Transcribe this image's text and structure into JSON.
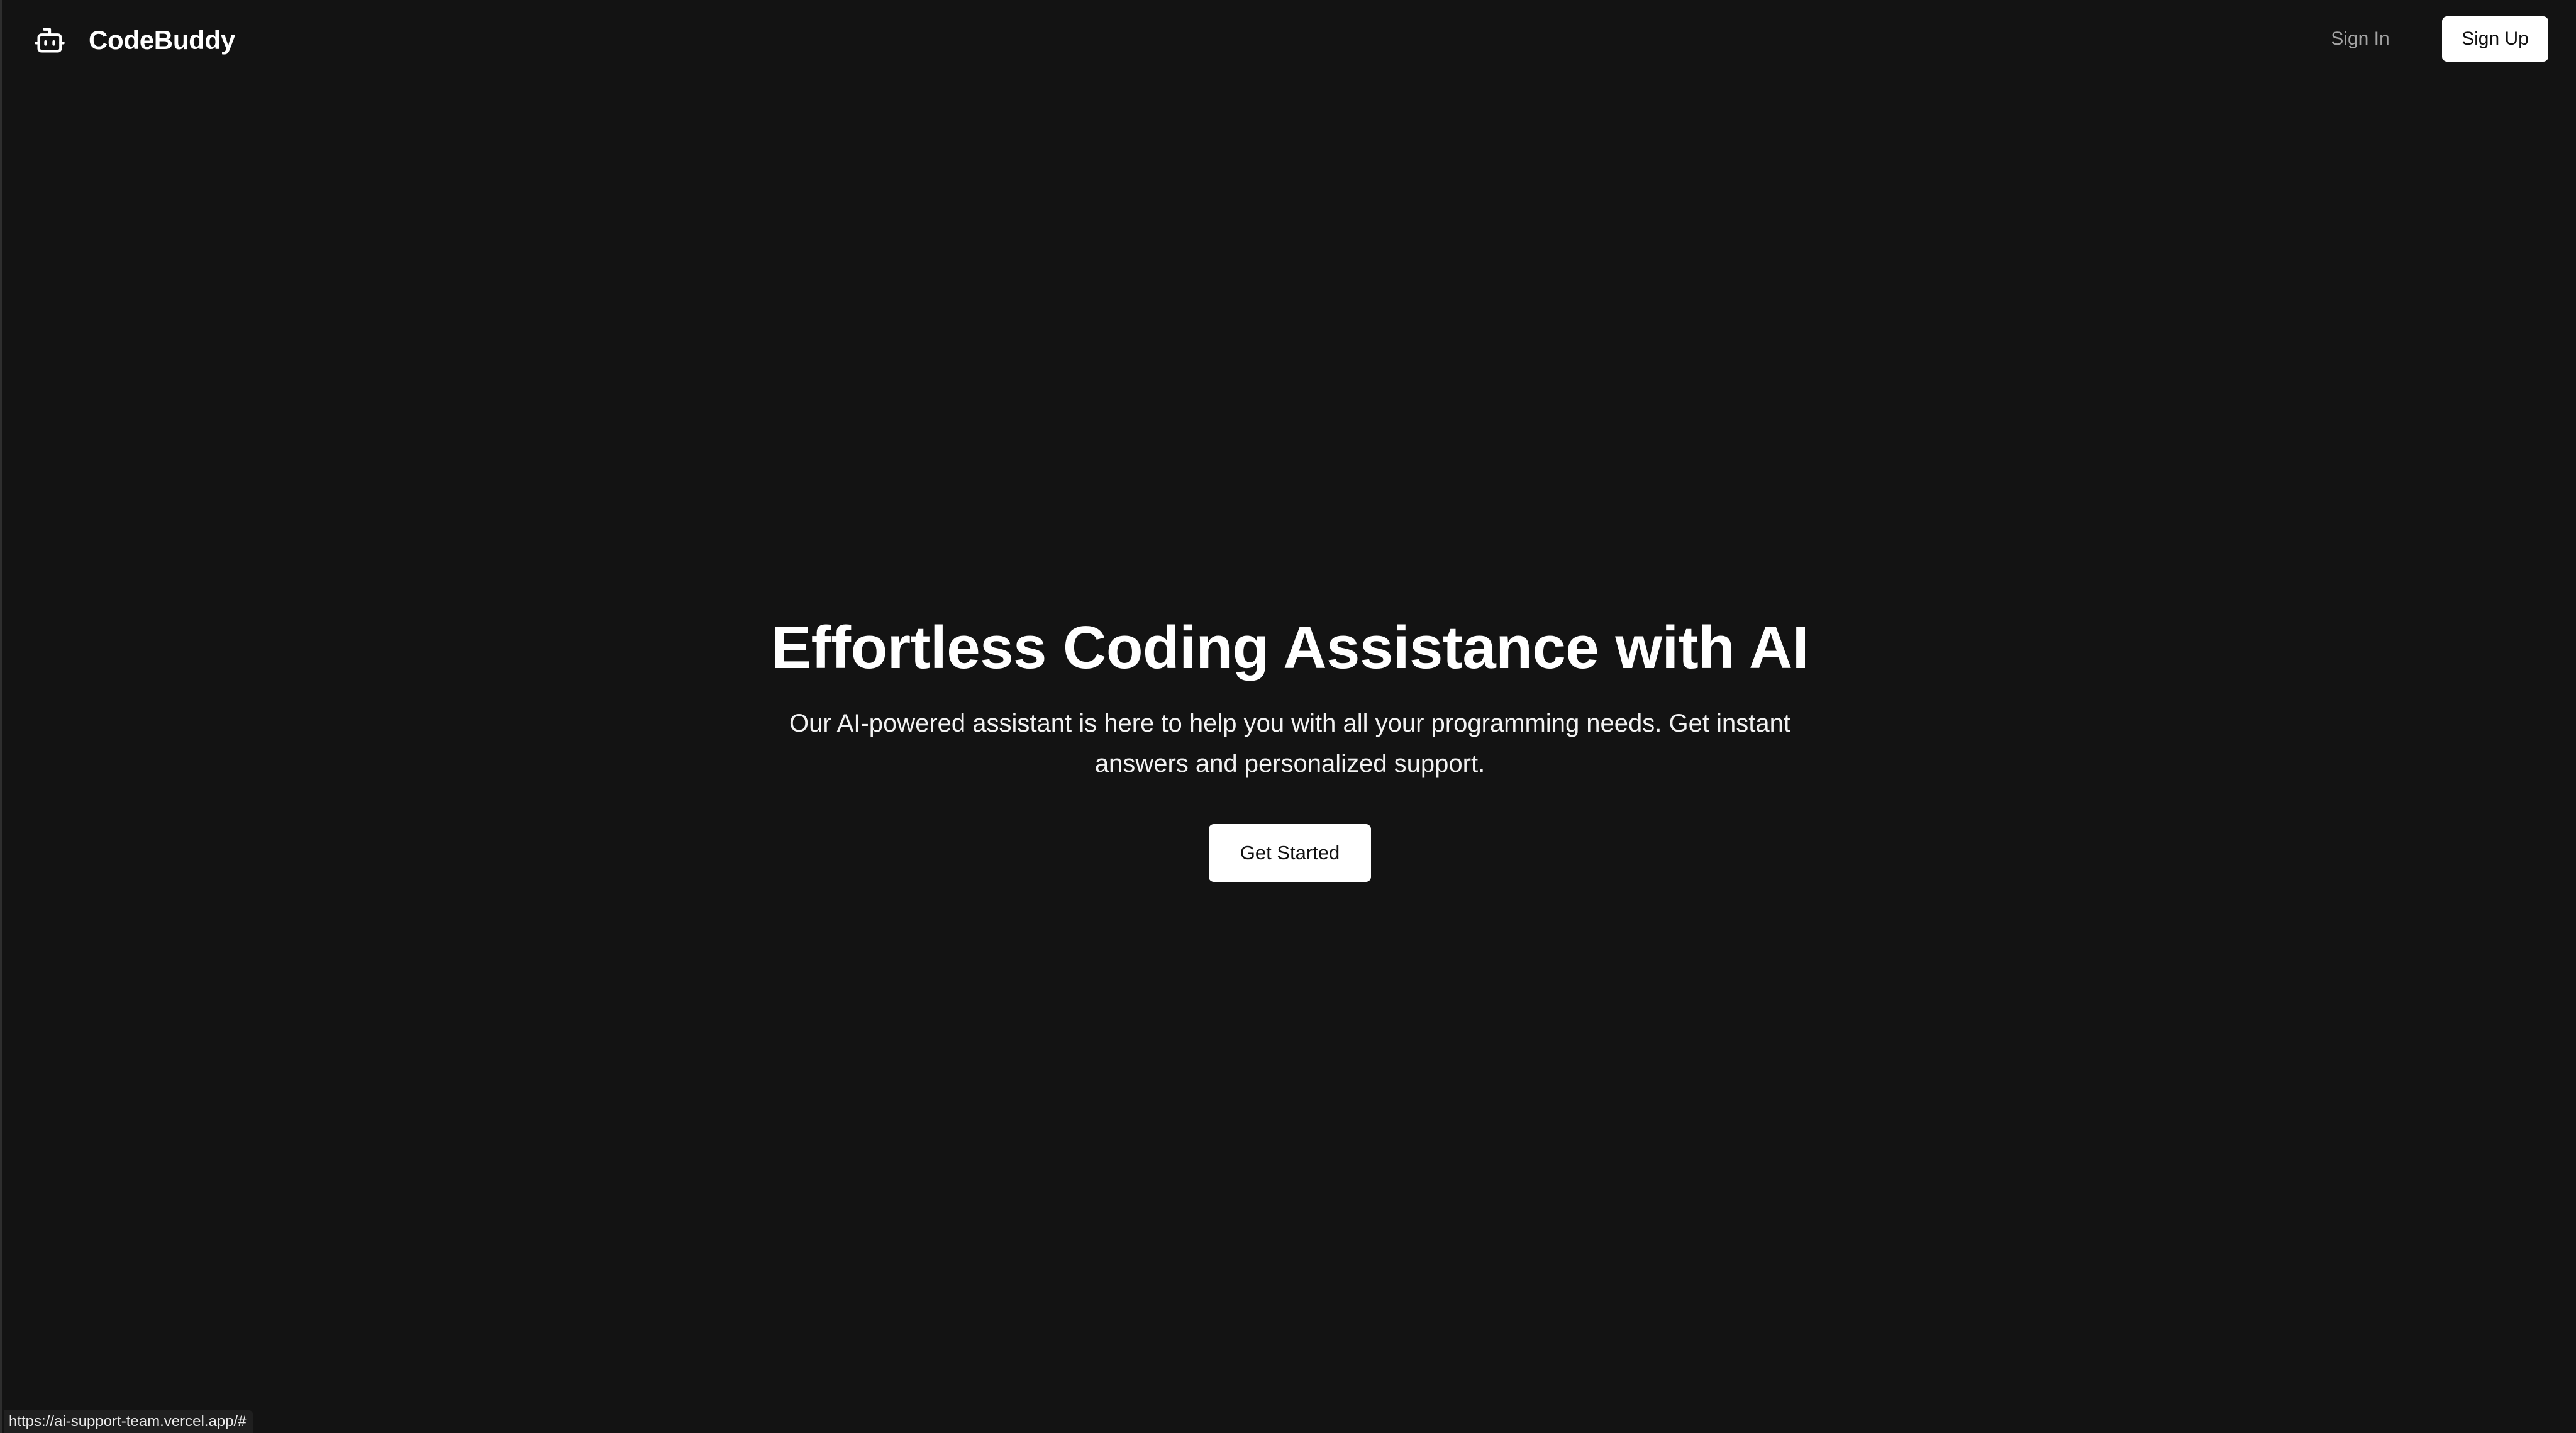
{
  "header": {
    "brand_name": "CodeBuddy",
    "brand_icon": "bot-icon",
    "signin_label": "Sign In",
    "signup_label": "Sign Up"
  },
  "hero": {
    "title": "Effortless Coding Assistance with AI",
    "subtitle": "Our AI-powered assistant is here to help you with all your programming needs. Get instant answers and personalized support.",
    "cta_label": "Get Started"
  },
  "status_bar": {
    "url": "https://ai-support-team.vercel.app/#"
  },
  "colors": {
    "background": "#131313",
    "text_primary": "#ffffff",
    "text_muted": "#a3a3a3",
    "button_bg": "#ffffff",
    "button_text": "#111111"
  }
}
